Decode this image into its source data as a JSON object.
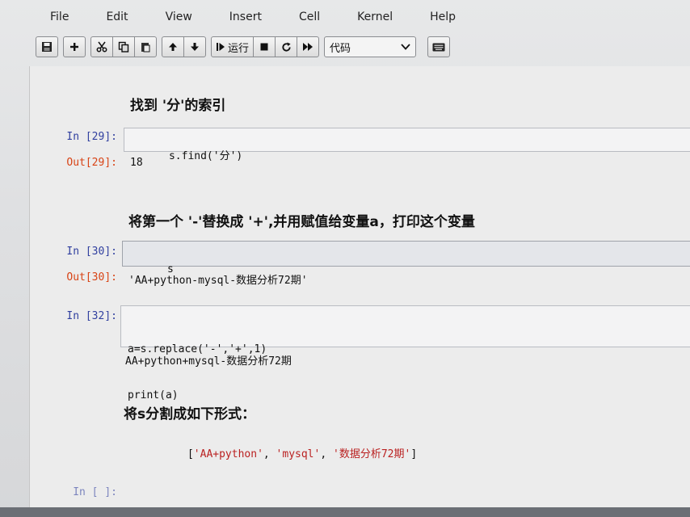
{
  "menu": [
    "File",
    "Edit",
    "View",
    "Insert",
    "Cell",
    "Kernel",
    "Help"
  ],
  "toolbar": {
    "run_label": "运行",
    "cell_type": "代码",
    "icons": [
      "save-icon",
      "plus-icon",
      "cut-icon",
      "copy-icon",
      "paste-icon",
      "arrow-up-icon",
      "arrow-down-icon",
      "run-icon",
      "stop-icon",
      "restart-icon",
      "fast-forward-icon",
      "keyboard-icon"
    ]
  },
  "cells": {
    "h1": "找到 '分'的索引",
    "c29_prompt": "In [29]:",
    "c29_code": "s.find('分')",
    "o29_prompt": "Out[29]:",
    "o29_value": "18",
    "h2": "将第一个 '-'替换成 '+',并用赋值给变量a，打印这个变量",
    "c30_prompt": "In [30]:",
    "c30_code": "s",
    "o30_prompt": "Out[30]:",
    "o30_value": "'AA+python-mysql-数据分析72期'",
    "c32_prompt": "In [32]:",
    "c32_code_line1": "a=s.replace('-','+',1)",
    "c32_code_line2": "print(a)",
    "o32_value": "AA+python+mysql-数据分析72期",
    "h3": "将s分割成如下形式：",
    "list_open": "[",
    "list_item1": "'AA+python'",
    "list_sep1": ", ",
    "list_item2": "'mysql'",
    "list_sep2": ", ",
    "list_item3": "'数据分析72期'",
    "list_close": "]",
    "next_prompt": "In [ ]:"
  }
}
